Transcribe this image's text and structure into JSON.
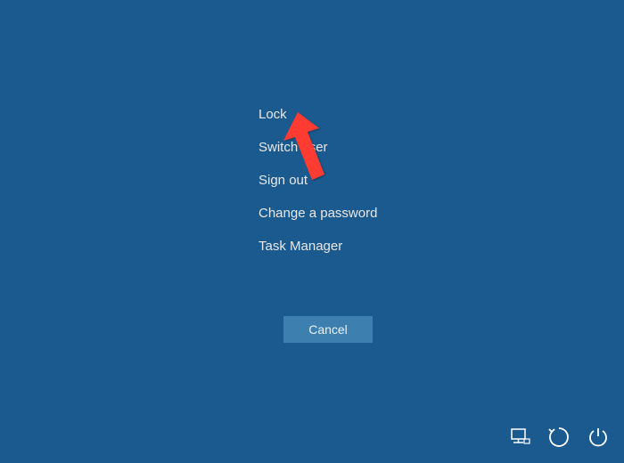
{
  "menu": {
    "items": [
      {
        "label": "Lock"
      },
      {
        "label": "Switch user"
      },
      {
        "label": "Sign out"
      },
      {
        "label": "Change a password"
      },
      {
        "label": "Task Manager"
      }
    ]
  },
  "buttons": {
    "cancel_label": "Cancel"
  },
  "colors": {
    "background": "#1b5a8e",
    "button_bg": "#3d80b0",
    "text": "#e8e8e8",
    "annotation_arrow": "#ff3b30"
  }
}
